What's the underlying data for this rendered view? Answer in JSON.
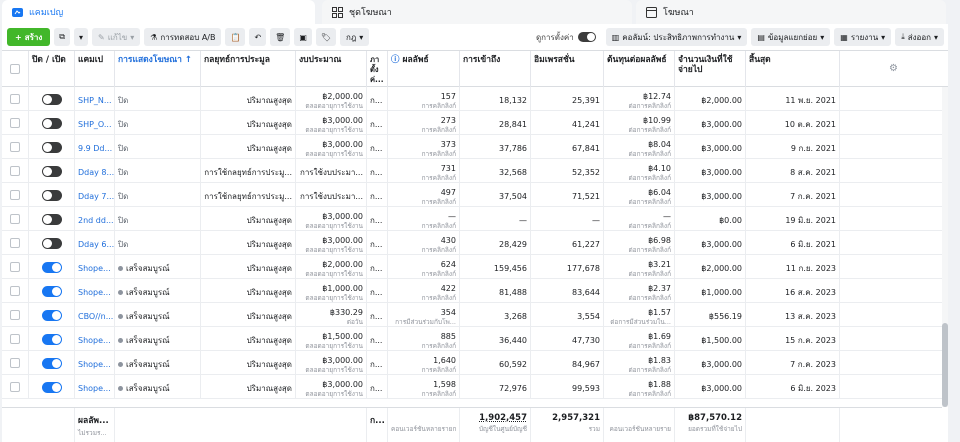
{
  "tabs": [
    {
      "label": "แคมเปญ",
      "icon": "folder-icon",
      "active": true
    },
    {
      "label": "ชุดโฆษณา",
      "icon": "grid-icon",
      "active": false
    },
    {
      "label": "โฆษณา",
      "icon": "ad-icon",
      "active": false
    }
  ],
  "toolbar": {
    "create": "สร้าง",
    "edit": "แก้ไข",
    "ab_test": "การทดสอบ A/B",
    "rules": "กฎ",
    "comparison": "ดูการตั้งค่า",
    "columns": "คอลัมน์: ประสิทธิภาพการทำงาน",
    "breakdown": "ข้อมูลแยกย่อย",
    "reports": "รายงาน",
    "export": "ส่งออก"
  },
  "headers": {
    "onoff": "ปิด / เปิด",
    "campaign": "แคมเป",
    "delivery": "การแสดงโฆษณา ↑",
    "bid": "กลยุทธ์การประมูล",
    "budget": "งบประมาณ",
    "attribution": "ภา ตั้ง ค่...",
    "results": "ผลลัพธ์",
    "reach": "การเข้าถึง",
    "impressions": "อิมเพรสชั่น",
    "cpr": "ต้นทุนต่อผลลัพธ์",
    "spent": "จำนวนเงินที่ใช้จ่ายไป",
    "ends": "สิ้นสุด"
  },
  "rows": [
    {
      "on": false,
      "name": "SHP_N...",
      "delivery": "ปิด",
      "bid": "ปริมาณสูงสุด",
      "budget": "฿2,000.00",
      "budget_sub": "ตลอดอายุการใช้งาน",
      "attr": "ก...",
      "results": "157",
      "results_sub": "การคลิกลิงก์",
      "reach": "18,132",
      "impr": "25,391",
      "cpr": "฿12.74",
      "cpr_sub": "ต่อการคลิกลิงก์",
      "spent": "฿2,000.00",
      "ends": "11 พ.ย. 2021"
    },
    {
      "on": false,
      "name": "SHP_O...",
      "delivery": "ปิด",
      "bid": "ปริมาณสูงสุด",
      "budget": "฿3,000.00",
      "budget_sub": "ตลอดอายุการใช้งาน",
      "attr": "ก...",
      "results": "273",
      "results_sub": "การคลิกลิงก์",
      "reach": "28,841",
      "impr": "41,241",
      "cpr": "฿10.99",
      "cpr_sub": "ต่อการคลิกลิงก์",
      "spent": "฿3,000.00",
      "ends": "10 ต.ค. 2021"
    },
    {
      "on": false,
      "name": "9.9 Dd...",
      "delivery": "ปิด",
      "bid": "ปริมาณสูงสุด",
      "budget": "฿3,000.00",
      "budget_sub": "ตลอดอายุการใช้งาน",
      "attr": "ก...",
      "results": "373",
      "results_sub": "การคลิกลิงก์",
      "reach": "37,786",
      "impr": "67,841",
      "cpr": "฿8.04",
      "cpr_sub": "ต่อการคลิกลิงก์",
      "spent": "฿3,000.00",
      "ends": "9 ก.ย. 2021"
    },
    {
      "on": false,
      "name": "Dday 8...",
      "delivery": "ปิด",
      "bid": "การใช้กลยุทธ์การประมู...",
      "budget": "การใช้งบประมา...",
      "budget_sub": "",
      "attr": "ก...",
      "results": "731",
      "results_sub": "การคลิกลิงก์",
      "reach": "32,568",
      "impr": "52,352",
      "cpr": "฿4.10",
      "cpr_sub": "ต่อการคลิกลิงก์",
      "spent": "฿3,000.00",
      "ends": "8 ส.ค. 2021"
    },
    {
      "on": false,
      "name": "Dday 7...",
      "delivery": "ปิด",
      "bid": "การใช้กลยุทธ์การประมู...",
      "budget": "การใช้งบประมา...",
      "budget_sub": "",
      "attr": "ก...",
      "results": "497",
      "results_sub": "การคลิกลิงก์",
      "reach": "37,504",
      "impr": "71,521",
      "cpr": "฿6.04",
      "cpr_sub": "ต่อการคลิกลิงก์",
      "spent": "฿3,000.00",
      "ends": "7 ก.ค. 2021"
    },
    {
      "on": false,
      "name": "2nd dd...",
      "delivery": "ปิด",
      "bid": "ปริมาณสูงสุด",
      "budget": "฿3,000.00",
      "budget_sub": "ตลอดอายุการใช้งาน",
      "attr": "ก...",
      "results": "—",
      "results_sub": "การคลิกลิงก์",
      "reach": "—",
      "impr": "—",
      "cpr": "—",
      "cpr_sub": "ต่อการคลิกลิงก์",
      "spent": "฿0.00",
      "ends": "19 มิ.ย. 2021"
    },
    {
      "on": false,
      "name": "Dday 6...",
      "delivery": "ปิด",
      "bid": "ปริมาณสูงสุด",
      "budget": "฿3,000.00",
      "budget_sub": "ตลอดอายุการใช้งาน",
      "attr": "ก...",
      "results": "430",
      "results_sub": "การคลิกลิงก์",
      "reach": "28,429",
      "impr": "61,227",
      "cpr": "฿6.98",
      "cpr_sub": "ต่อการคลิกลิงก์",
      "spent": "฿3,000.00",
      "ends": "6 มิ.ย. 2021"
    },
    {
      "on": true,
      "name": "Shope...",
      "delivery": "เสร็จสมบูรณ์",
      "bid": "ปริมาณสูงสุด",
      "budget": "฿2,000.00",
      "budget_sub": "ตลอดอายุการใช้งาน",
      "attr": "ก...",
      "results": "624",
      "results_sub": "การคลิกลิงก์",
      "reach": "159,456",
      "impr": "177,678",
      "cpr": "฿3.21",
      "cpr_sub": "ต่อการคลิกลิงก์",
      "spent": "฿2,000.00",
      "ends": "11 ก.ย. 2023"
    },
    {
      "on": true,
      "name": "Shope...",
      "delivery": "เสร็จสมบูรณ์",
      "bid": "ปริมาณสูงสุด",
      "budget": "฿1,000.00",
      "budget_sub": "ตลอดอายุการใช้งาน",
      "attr": "ก...",
      "results": "422",
      "results_sub": "การคลิกลิงก์",
      "reach": "81,488",
      "impr": "83,644",
      "cpr": "฿2.37",
      "cpr_sub": "ต่อการคลิกลิงก์",
      "spent": "฿1,000.00",
      "ends": "16 ส.ค. 2023"
    },
    {
      "on": true,
      "name": "CBO//n...",
      "delivery": "เสร็จสมบูรณ์",
      "bid": "ปริมาณสูงสุด",
      "budget": "฿330.29",
      "budget_sub": "ต่อวัน",
      "attr": "ก...",
      "results": "354",
      "results_sub": "การมีส่วนร่วมกับโพ...",
      "reach": "3,268",
      "impr": "3,554",
      "cpr": "฿1.57",
      "cpr_sub": "ต่อการมีส่วนร่วมใน...",
      "spent": "฿556.19",
      "ends": "13 ส.ค. 2023"
    },
    {
      "on": true,
      "name": "Shope...",
      "delivery": "เสร็จสมบูรณ์",
      "bid": "ปริมาณสูงสุด",
      "budget": "฿1,500.00",
      "budget_sub": "ตลอดอายุการใช้งาน",
      "attr": "ก...",
      "results": "885",
      "results_sub": "การคลิกลิงก์",
      "reach": "36,440",
      "impr": "47,730",
      "cpr": "฿1.69",
      "cpr_sub": "ต่อการคลิกลิงก์",
      "spent": "฿1,500.00",
      "ends": "15 ก.ค. 2023"
    },
    {
      "on": true,
      "name": "Shope...",
      "delivery": "เสร็จสมบูรณ์",
      "bid": "ปริมาณสูงสุด",
      "budget": "฿3,000.00",
      "budget_sub": "ตลอดอายุการใช้งาน",
      "attr": "ก...",
      "results": "1,640",
      "results_sub": "การคลิกลิงก์",
      "reach": "60,592",
      "impr": "84,967",
      "cpr": "฿1.83",
      "cpr_sub": "ต่อการคลิกลิงก์",
      "spent": "฿3,000.00",
      "ends": "7 ก.ค. 2023"
    },
    {
      "on": true,
      "name": "Shope...",
      "delivery": "เสร็จสมบูรณ์",
      "bid": "ปริมาณสูงสุด",
      "budget": "฿3,000.00",
      "budget_sub": "ตลอดอายุการใช้งาน",
      "attr": "ก...",
      "results": "1,598",
      "results_sub": "การคลิกลิงก์",
      "reach": "72,976",
      "impr": "99,593",
      "cpr": "฿1.88",
      "cpr_sub": "ต่อการคลิกลิงก์",
      "spent": "฿3,000.00",
      "ends": "6 มิ.ย. 2023"
    }
  ],
  "footer": {
    "label": "ผลลัพ...",
    "label_sub": "ไม่รวมร...",
    "attr": "ก...",
    "results_sub": "คอนเวอร์ชันหลายรายก",
    "reach": "1,902,457",
    "reach_sub": "บัญชีในศูนย์บัญชี",
    "impr": "2,957,321",
    "impr_sub": "รวม",
    "cpr_sub": "คอนเวอร์ชันหลายราย",
    "spent": "฿87,570.12",
    "spent_sub": "ยอดรวมที่ใช้จ่ายไป"
  },
  "colors": {
    "accent": "#1877f2",
    "create": "#42b72a",
    "link": "#216fdb"
  }
}
